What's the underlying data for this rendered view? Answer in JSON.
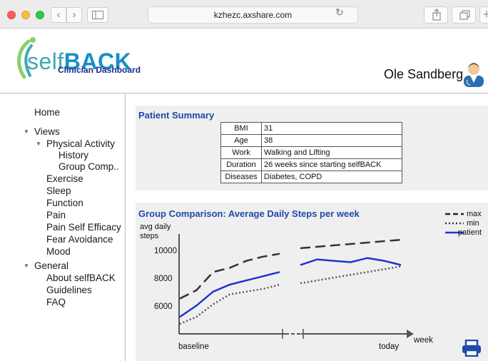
{
  "browser": {
    "url": "kzhezc.axshare.com",
    "back_glyph": "‹",
    "forward_glyph": "›",
    "reload_glyph": "↻",
    "new_tab_glyph": "+"
  },
  "header": {
    "brand_prefix": "self",
    "brand_suffix": "BACK",
    "subtitle": "Clinician Dashboard",
    "user_name": "Ole Sandberg"
  },
  "sidebar": {
    "home": "Home",
    "views": "Views",
    "physical_activity": "Physical Activity",
    "history": "History",
    "group_comp": "Group Comp..",
    "exercise": "Exercise",
    "sleep": "Sleep",
    "function": "Function",
    "pain": "Pain",
    "pain_self_efficacy": "Pain Self Efficacy",
    "fear_avoidance": "Fear Avoidance",
    "mood": "Mood",
    "general": "General",
    "about": "About selfBACK",
    "guidelines": "Guidelines",
    "faq": "FAQ"
  },
  "summary": {
    "title": "Patient Summary",
    "rows": [
      {
        "k": "BMI",
        "v": "31"
      },
      {
        "k": "Age",
        "v": "38"
      },
      {
        "k": "Work",
        "v": "Walking and Lifting"
      },
      {
        "k": "Duration",
        "v": "26 weeks since starting selfBACK"
      },
      {
        "k": "Diseases",
        "v": "Diabetes, COPD"
      }
    ]
  },
  "chart_data": {
    "type": "line",
    "title": "Group Comparison: Average Daily Steps per week",
    "ylabel": "avg daily steps",
    "xlabel": "week",
    "x_tick_labels": [
      "baseline",
      "today"
    ],
    "y_ticks": [
      6000,
      8000,
      10000
    ],
    "ylim": [
      5000,
      10800
    ],
    "axis_break": "x",
    "legend_position": "top-right",
    "series": [
      {
        "name": "max",
        "style": "dashed",
        "color": "#333333",
        "segment1": [
          [
            0,
            6800
          ],
          [
            1,
            7400
          ],
          [
            2,
            8700
          ],
          [
            3,
            9000
          ],
          [
            4,
            9500
          ],
          [
            5,
            9800
          ],
          [
            6,
            10000
          ]
        ],
        "segment2": [
          [
            0,
            10400
          ],
          [
            1,
            10500
          ],
          [
            2,
            10600
          ],
          [
            3,
            10700
          ],
          [
            4,
            10800
          ],
          [
            5,
            10900
          ],
          [
            6,
            11000
          ]
        ]
      },
      {
        "name": "min",
        "style": "dotted",
        "color": "#555555",
        "segment1": [
          [
            0,
            5000
          ],
          [
            1,
            5500
          ],
          [
            2,
            6400
          ],
          [
            3,
            7100
          ],
          [
            4,
            7300
          ],
          [
            5,
            7500
          ],
          [
            6,
            7800
          ]
        ],
        "segment2": [
          [
            0,
            7900
          ],
          [
            1,
            8100
          ],
          [
            2,
            8300
          ],
          [
            3,
            8500
          ],
          [
            4,
            8700
          ],
          [
            5,
            8900
          ],
          [
            6,
            9100
          ]
        ]
      },
      {
        "name": "patient",
        "style": "solid",
        "color": "#1f35c9",
        "segment1": [
          [
            0,
            5500
          ],
          [
            1,
            6300
          ],
          [
            2,
            7300
          ],
          [
            3,
            7800
          ],
          [
            4,
            8100
          ],
          [
            5,
            8400
          ],
          [
            6,
            8700
          ]
        ],
        "segment2": [
          [
            0,
            9200
          ],
          [
            1,
            9600
          ],
          [
            2,
            9500
          ],
          [
            3,
            9400
          ],
          [
            4,
            9700
          ],
          [
            5,
            9500
          ],
          [
            6,
            9200
          ]
        ]
      }
    ],
    "grid": false
  },
  "icons": {
    "print": "print-icon",
    "avatar": "doctor-avatar"
  },
  "colors": {
    "accent_blue": "#1f4aa8",
    "patient_line": "#1f35c9",
    "brand_teal": "#3fa9b5"
  }
}
